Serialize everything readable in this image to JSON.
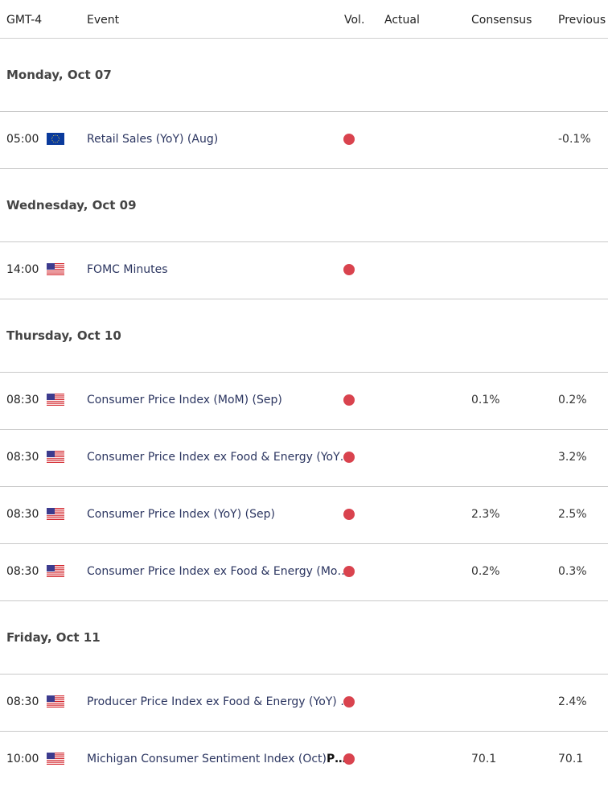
{
  "header": {
    "timezone": "GMT-4",
    "event": "Event",
    "vol": "Vol.",
    "actual": "Actual",
    "consensus": "Consensus",
    "previous": "Previous"
  },
  "colors": {
    "high_volatility": "#d9434e"
  },
  "groups": [
    {
      "date": "Monday, Oct 07",
      "events": [
        {
          "time": "05:00",
          "flag": "eu-flag-icon",
          "event": "Retail Sales (YoY) (Aug)",
          "event_bold": "",
          "vol": "high",
          "actual": "",
          "consensus": "",
          "previous": "-0.1%"
        }
      ]
    },
    {
      "date": "Wednesday, Oct 09",
      "events": [
        {
          "time": "14:00",
          "flag": "us-flag-icon",
          "event": "FOMC Minutes",
          "event_bold": "",
          "vol": "high",
          "actual": "",
          "consensus": "",
          "previous": ""
        }
      ]
    },
    {
      "date": "Thursday, Oct 10",
      "events": [
        {
          "time": "08:30",
          "flag": "us-flag-icon",
          "event": "Consumer Price Index (MoM) (Sep)",
          "event_bold": "",
          "vol": "high",
          "actual": "",
          "consensus": "0.1%",
          "previous": "0.2%"
        },
        {
          "time": "08:30",
          "flag": "us-flag-icon",
          "event": "Consumer Price Index ex Food & Energy (YoY…",
          "event_bold": "",
          "vol": "high",
          "actual": "",
          "consensus": "",
          "previous": "3.2%"
        },
        {
          "time": "08:30",
          "flag": "us-flag-icon",
          "event": "Consumer Price Index (YoY) (Sep)",
          "event_bold": "",
          "vol": "high",
          "actual": "",
          "consensus": "2.3%",
          "previous": "2.5%"
        },
        {
          "time": "08:30",
          "flag": "us-flag-icon",
          "event": "Consumer Price Index ex Food & Energy (Mo…",
          "event_bold": "",
          "vol": "high",
          "actual": "",
          "consensus": "0.2%",
          "previous": "0.3%"
        }
      ]
    },
    {
      "date": "Friday, Oct 11",
      "events": [
        {
          "time": "08:30",
          "flag": "us-flag-icon",
          "event": "Producer Price Index ex Food & Energy (YoY) …",
          "event_bold": "",
          "vol": "high",
          "actual": "",
          "consensus": "",
          "previous": "2.4%"
        },
        {
          "time": "10:00",
          "flag": "us-flag-icon",
          "event": "Michigan Consumer Sentiment Index (Oct)",
          "event_bold": "P…",
          "vol": "high",
          "actual": "",
          "consensus": "70.1",
          "previous": "70.1"
        }
      ]
    }
  ]
}
